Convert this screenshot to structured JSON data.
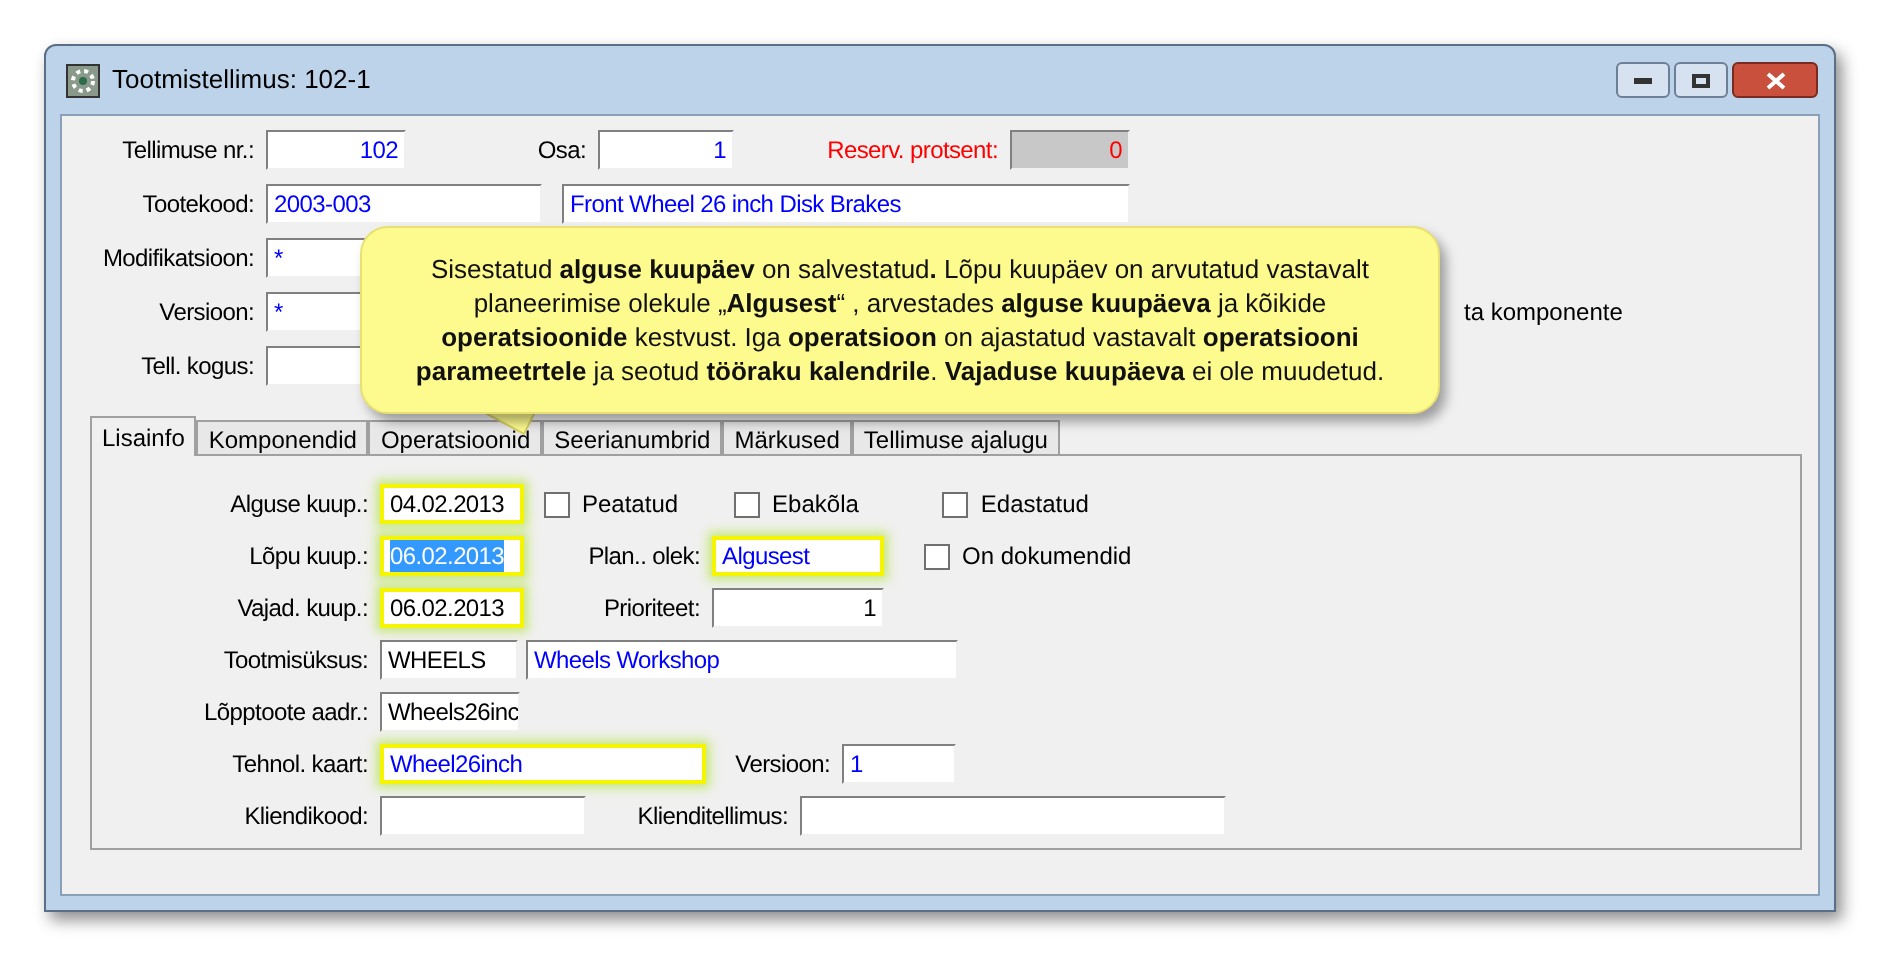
{
  "window": {
    "title": "Tootmistellimus: 102-1"
  },
  "header": {
    "order_no": {
      "label": "Tellimuse nr.:",
      "value": "102",
      "color": "#0000ff"
    },
    "part": {
      "label": "Osa:",
      "value": "1",
      "color": "#0000ff"
    },
    "reserve_percent": {
      "label": "Reserv. protsent:",
      "value": "0",
      "color": "#ff0000",
      "disabled": true
    },
    "product_code": {
      "label": "Tootekood:",
      "value": "2003-003",
      "color": "#0000ff"
    },
    "product_name": {
      "value": "Front Wheel 26 inch Disk Brakes",
      "color": "#0000ff"
    },
    "modification": {
      "label": "Modifikatsioon:",
      "value": "*",
      "color": "#0000ff"
    },
    "version": {
      "label": "Versioon:",
      "value": "*",
      "color": "#0000ff"
    },
    "quantity": {
      "label": "Tell. kogus:"
    },
    "side_note": "ta komponente"
  },
  "tabs": [
    {
      "label": "Lisainfo",
      "selected": true
    },
    {
      "label": "Komponendid",
      "selected": false
    },
    {
      "label": "Operatsioonid",
      "selected": false
    },
    {
      "label": "Seerianumbrid",
      "selected": false
    },
    {
      "label": "Märkused",
      "selected": false
    },
    {
      "label": "Tellimuse ajalugu",
      "selected": false
    }
  ],
  "lisainfo": {
    "start_date": {
      "label": "Alguse kuup.:",
      "value": "04.02.2013",
      "color": "#000000",
      "highlighted": true,
      "text_selected": false
    },
    "end_date": {
      "label": "Lõpu kuup.:",
      "value": "06.02.2013",
      "highlighted": true,
      "text_selected": true
    },
    "need_date": {
      "label": "Vajad. kuup.:",
      "value": "06.02.2013",
      "color": "#000000",
      "highlighted": true,
      "text_selected": false
    },
    "checkboxes": [
      {
        "label": "Peatatud",
        "checked": false
      },
      {
        "label": "Ebakõla",
        "checked": false
      },
      {
        "label": "Edastatud",
        "checked": false
      },
      {
        "label": "On dokumendid",
        "checked": false
      }
    ],
    "plan_status": {
      "label": "Plan.. olek:",
      "value": "Algusest",
      "color": "#0000ff",
      "highlighted": true
    },
    "priority": {
      "label": "Prioriteet:",
      "value": "1",
      "color": "#000000"
    },
    "production_unit": {
      "label": "Tootmisüksus:",
      "value": "WHEELS",
      "color": "#000000"
    },
    "unit_name": {
      "value": "Wheels Workshop",
      "color": "#0000ff"
    },
    "end_product_address": {
      "label": "Lõpptoote aadr.:",
      "value": "Wheels26inc",
      "color": "#000000"
    },
    "routing": {
      "label": "Tehnol. kaart:",
      "value": "Wheel26inch",
      "color": "#0000ff",
      "highlighted": true
    },
    "routing_version": {
      "label": "Versioon:",
      "value": "1",
      "color": "#0000ff"
    },
    "customer_code": {
      "label": "Kliendikood:"
    },
    "customer_order": {
      "label": "Klienditellimus:"
    }
  },
  "callout": {
    "text": "Sisestatud **alguse kuupäev** on salvestatud**.** Lõpu kuupäev on arvutatud vastavalt planeerimise olekule „**Algusest**“ , arvestades **alguse kuupäeva** ja kõikide **operatsioonide** kestvust. Iga **operatsioon** on ajastatud vastavalt **operatsiooni parameetrtele** ja seotud **tööraku kalendrile**. **Vajaduse kuupäeva** ei ole muudetud."
  }
}
